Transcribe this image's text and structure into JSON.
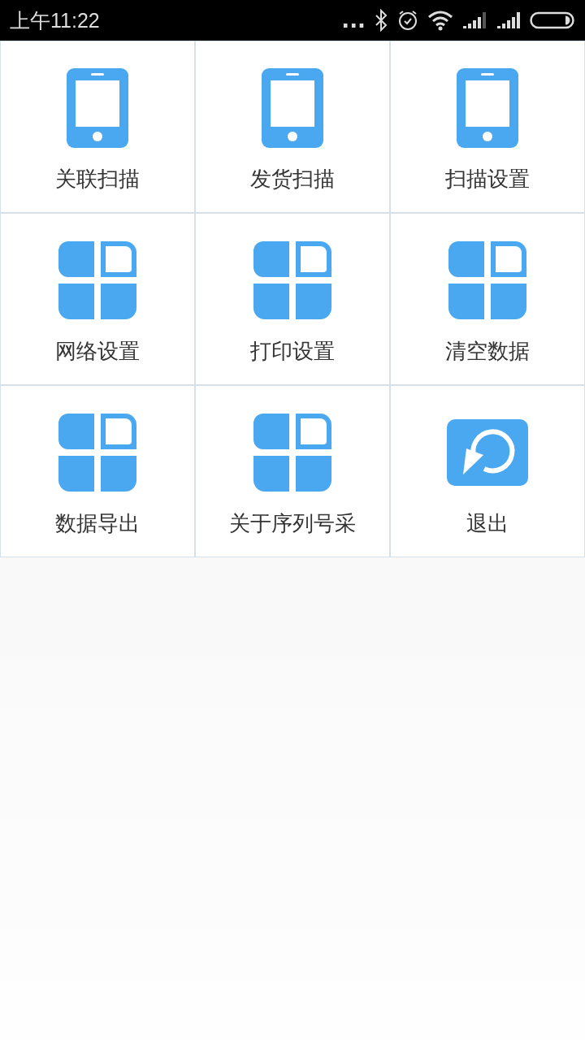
{
  "status_bar": {
    "time": "上午11:22",
    "dots": "..."
  },
  "menu": [
    {
      "label": "关联扫描",
      "kind": "phone"
    },
    {
      "label": "发货扫描",
      "kind": "phone"
    },
    {
      "label": "扫描设置",
      "kind": "phone"
    },
    {
      "label": "网络设置",
      "kind": "tiles"
    },
    {
      "label": "打印设置",
      "kind": "tiles"
    },
    {
      "label": "清空数据",
      "kind": "tiles"
    },
    {
      "label": "数据导出",
      "kind": "tiles"
    },
    {
      "label": "关于序列号采",
      "kind": "tiles"
    },
    {
      "label": "退出",
      "kind": "exit"
    }
  ]
}
